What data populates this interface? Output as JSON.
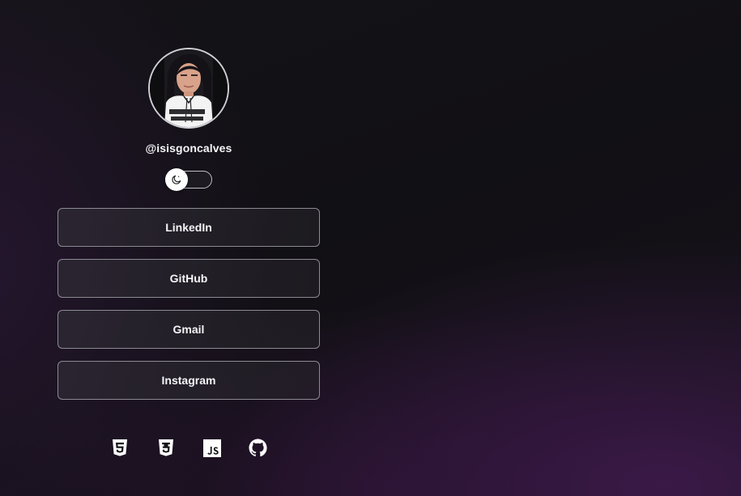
{
  "profile": {
    "username": "@isisgoncalves",
    "avatar_icon": "profile-photo"
  },
  "theme_toggle": {
    "icon": "moon-icon",
    "state": "dark"
  },
  "links": [
    {
      "label": "LinkedIn"
    },
    {
      "label": "GitHub"
    },
    {
      "label": "Gmail"
    },
    {
      "label": "Instagram"
    }
  ],
  "footer_icons": [
    "html5-icon",
    "css3-icon",
    "javascript-icon",
    "github-icon"
  ],
  "colors": {
    "background": "#121115",
    "accent_glow": "#401a4e",
    "button_border": "#8c8a92",
    "text": "#f4f4f6"
  }
}
